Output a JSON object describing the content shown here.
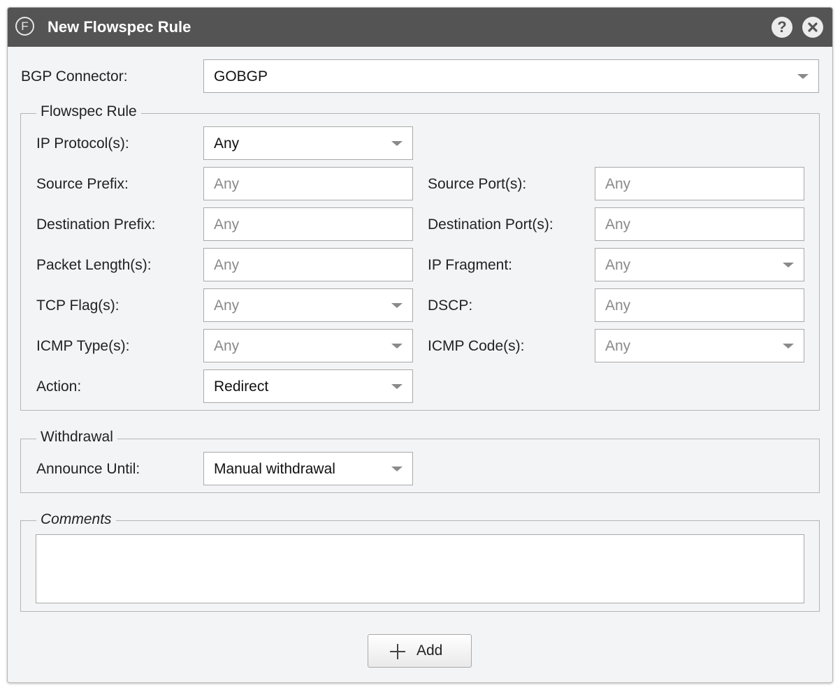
{
  "dialog": {
    "title": "New Flowspec Rule",
    "logo_letter": "F",
    "help_label": "?",
    "icons": {
      "logo": "flowspec-logo-icon",
      "help": "help-icon",
      "close": "close-icon",
      "add": "plus-icon"
    }
  },
  "bgp": {
    "label": "BGP Connector:",
    "value": "GOBGP"
  },
  "flowspec": {
    "legend": "Flowspec Rule",
    "ip_protocol": {
      "label": "IP Protocol(s):",
      "value": "Any"
    },
    "source_prefix": {
      "label": "Source Prefix:",
      "placeholder": "Any"
    },
    "source_ports": {
      "label": "Source Port(s):",
      "placeholder": "Any"
    },
    "destination_prefix": {
      "label": "Destination Prefix:",
      "placeholder": "Any"
    },
    "destination_ports": {
      "label": "Destination Port(s):",
      "placeholder": "Any"
    },
    "packet_length": {
      "label": "Packet Length(s):",
      "placeholder": "Any"
    },
    "ip_fragment": {
      "label": "IP Fragment:",
      "placeholder": "Any"
    },
    "tcp_flags": {
      "label": "TCP Flag(s):",
      "placeholder": "Any"
    },
    "dscp": {
      "label": "DSCP:",
      "placeholder": "Any"
    },
    "icmp_type": {
      "label": "ICMP Type(s):",
      "placeholder": "Any"
    },
    "icmp_code": {
      "label": "ICMP Code(s):",
      "placeholder": "Any"
    },
    "action": {
      "label": "Action:",
      "value": "Redirect"
    }
  },
  "withdrawal": {
    "legend": "Withdrawal",
    "announce_until": {
      "label": "Announce Until:",
      "value": "Manual withdrawal"
    }
  },
  "comments": {
    "legend": "Comments",
    "value": ""
  },
  "footer": {
    "add_label": "Add"
  }
}
